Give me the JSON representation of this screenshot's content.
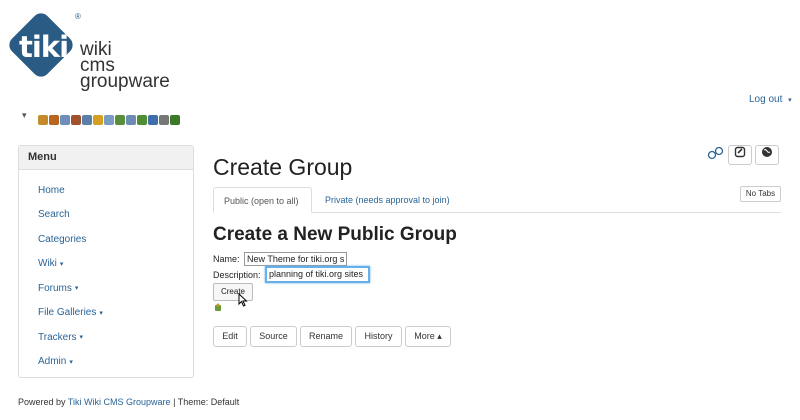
{
  "logo": {
    "badge_text": "tiki",
    "registered": "®",
    "lines": [
      "wiki",
      "cms",
      "groupware"
    ],
    "badge_color": "#2a5b84"
  },
  "admin_toolbar": {
    "caret": "▾",
    "icons": [
      {
        "name": "tools-icon",
        "color": "#c58b2b"
      },
      {
        "name": "home-icon",
        "color": "#b8651f"
      },
      {
        "name": "pencil-icon",
        "color": "#6f8fb8"
      },
      {
        "name": "user-icon",
        "color": "#a0522d"
      },
      {
        "name": "users-icon",
        "color": "#5a7fa8"
      },
      {
        "name": "key-icon",
        "color": "#d4a020"
      },
      {
        "name": "table-icon",
        "color": "#7a9cc0"
      },
      {
        "name": "image-icon",
        "color": "#5b8e3a"
      },
      {
        "name": "calendar-icon",
        "color": "#6c8cb4"
      },
      {
        "name": "puzzle-icon",
        "color": "#4f8f2f"
      },
      {
        "name": "book-icon",
        "color": "#3f6fa8"
      },
      {
        "name": "card-icon",
        "color": "#777777"
      },
      {
        "name": "leaf-icon",
        "color": "#3b7a2a"
      }
    ]
  },
  "header": {
    "logout": "Log out",
    "logout_caret": "▾"
  },
  "menu": {
    "title": "Menu",
    "items": [
      {
        "label": "Home",
        "caret": ""
      },
      {
        "label": "Search",
        "caret": ""
      },
      {
        "label": "Categories",
        "caret": ""
      },
      {
        "label": "Wiki",
        "caret": "▾"
      },
      {
        "label": "Forums",
        "caret": "▾"
      },
      {
        "label": "File Galleries",
        "caret": "▾"
      },
      {
        "label": "Trackers",
        "caret": "▾"
      },
      {
        "label": "Admin",
        "caret": "▾"
      }
    ]
  },
  "page": {
    "title": "Create Group",
    "no_tabs": "No Tabs",
    "tabs": [
      "Public (open to all)",
      "Private (needs approval to join)"
    ],
    "subtitle": "Create a New Public Group",
    "name_label": "Name:",
    "name_value": "New Theme for tiki.org s",
    "description_label": "Description:",
    "description_value": "planning of tiki.org sites",
    "create_button": "Create",
    "actions": [
      "Edit",
      "Source",
      "Rename",
      "History",
      "More ▴"
    ]
  },
  "footer": {
    "prefix": "Powered by ",
    "link": "Tiki Wiki CMS Groupware",
    "suffix": " | Theme: Default"
  }
}
